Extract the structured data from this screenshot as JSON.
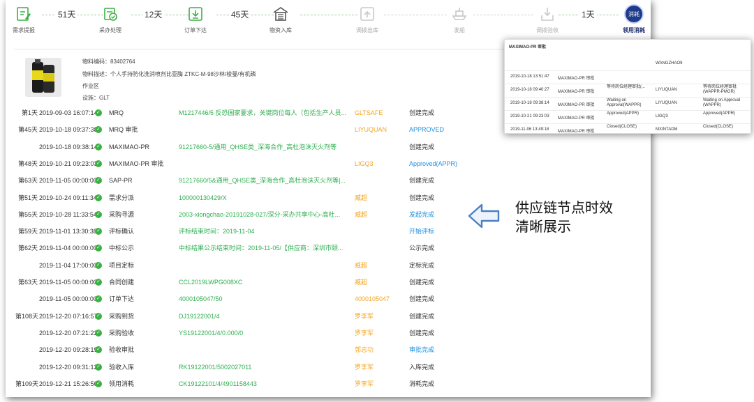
{
  "stepper": {
    "steps": [
      {
        "label": "需求提报",
        "icon": "edit-icon",
        "state": "done"
      },
      {
        "label": "采办处理",
        "icon": "cart-check-icon",
        "state": "done"
      },
      {
        "label": "订单下达",
        "icon": "download-box-icon",
        "state": "done"
      },
      {
        "label": "物资入库",
        "icon": "warehouse-icon",
        "state": "done"
      },
      {
        "label": "调拨出库",
        "icon": "upload-box-icon",
        "state": "pending"
      },
      {
        "label": "发船",
        "icon": "ship-icon",
        "state": "pending"
      },
      {
        "label": "调拨验收",
        "icon": "receive-box-icon",
        "state": "pending"
      },
      {
        "label": "领用消耗",
        "icon": "consume-icon",
        "state": "active",
        "badge": "消耗"
      }
    ],
    "durations": [
      "51天",
      "12天",
      "45天",
      "1天"
    ]
  },
  "material": {
    "code_label": "物料编码",
    "code": "83402764",
    "desc_label": "物料描述",
    "desc": "个人手持防化洗消喷剂比亚酶 ZTKC-M-98沙林/梭曼/有机磷",
    "area_label": "作业区",
    "area": "",
    "facility_label": "设施",
    "facility": "GLT"
  },
  "timeline": [
    {
      "day": "第1天",
      "time": "2019-09-03 16:07:14",
      "node": "MRQ",
      "doc": "M1217446/5 反恐国家要求，关键岗位每人（包括生产人员...",
      "user": "GLTSAFE",
      "status": "创建完成",
      "status_blue": false
    },
    {
      "day": "第45天",
      "time": "2019-10-18 09:37:38",
      "node": "MRQ 审批",
      "doc": "",
      "user": "LIYUQUAN",
      "status": "APPROVED",
      "status_blue": true
    },
    {
      "day": "",
      "time": "2019-10-18 09:38:14",
      "node": "MAXIMAO-PR",
      "doc": "91217660-5/通用_QHSE类_深海合作_高杜泡沫灭火剂等",
      "user": "",
      "status": "创建完成",
      "status_blue": false
    },
    {
      "day": "第48天",
      "time": "2019-10-21 09:23:03",
      "node": "MAXIMAO-PR 审批",
      "doc": "",
      "user": "LIGQ3",
      "status": "Approved(APPR)",
      "status_blue": true
    },
    {
      "day": "第63天",
      "time": "2019-11-05 00:00:00",
      "node": "SAP-PR",
      "doc": "91217660/5&通用_QHSE类_深海合作_高杜泡沫灭火剂等|...",
      "user": "",
      "status": "创建完成",
      "status_blue": false
    },
    {
      "day": "第51天",
      "time": "2019-10-24 09:11:34",
      "node": "需求分派",
      "doc": "100000130429/X",
      "user": "臧超",
      "status": "创建完成",
      "status_blue": false
    },
    {
      "day": "第55天",
      "time": "2019-10-28 11:33:54",
      "node": "采购寻源",
      "doc": "2003-xiongchao-20191028-027/深分-采办共享中心-高杜...",
      "user": "臧超",
      "status": "发起完成",
      "status_blue": true
    },
    {
      "day": "第59天",
      "time": "2019-11-01 13:30:38",
      "node": "评标确认",
      "doc": "评标结束时间：2019-11-04",
      "user": "",
      "status": "开始评标",
      "status_blue": true
    },
    {
      "day": "第62天",
      "time": "2019-11-04 00:00:00",
      "node": "中标公示",
      "doc": "中标结果公示结束时间：2019-11-05/【供应商：深圳市颐...",
      "user": "",
      "status": "公示完成",
      "status_blue": false
    },
    {
      "day": "",
      "time": "2019-11-04 17:00:00",
      "node": "项目定标",
      "doc": "",
      "user": "臧超",
      "status": "定标完成",
      "status_blue": false
    },
    {
      "day": "第63天",
      "time": "2019-11-05 00:00:00",
      "node": "合同创建",
      "doc": "CCL2019LWPG008XC",
      "user": "臧超",
      "status": "创建完成",
      "status_blue": false
    },
    {
      "day": "",
      "time": "2019-11-05 00:00:00",
      "node": "订单下达",
      "doc": "4000105047/50",
      "user": "4000105047",
      "status": "创建完成",
      "status_blue": false
    },
    {
      "day": "第108天",
      "time": "2019-12-20 07:16:57",
      "node": "采购到货",
      "doc": "DJ19122001/4",
      "user": "罗李军",
      "status": "创建完成",
      "status_blue": false
    },
    {
      "day": "",
      "time": "2019-12-20 07:21:22",
      "node": "采购验收",
      "doc": "YS19122001/4/0.000/0",
      "user": "罗李军",
      "status": "创建完成",
      "status_blue": false
    },
    {
      "day": "",
      "time": "2019-12-20 09:28:19",
      "node": "验收审批",
      "doc": "",
      "user": "郭志功",
      "status": "审批完成",
      "status_blue": true
    },
    {
      "day": "",
      "time": "2019-12-20 09:31:12",
      "node": "验收入库",
      "doc": "RK19122001/5002027011",
      "user": "罗李军",
      "status": "入库完成",
      "status_blue": false
    },
    {
      "day": "第109天",
      "time": "2019-12-21 15:26:50",
      "node": "领用消耗",
      "doc": "CK19122101/4/4901158443",
      "user": "罗李军",
      "status": "消耗完成",
      "status_blue": false
    }
  ],
  "popup": {
    "title": "MAXIMAO-PR 审批",
    "rows": [
      {
        "time": "",
        "node": "",
        "status": "",
        "user": "WANGZHAO9",
        "remark": ""
      },
      {
        "time": "2019-10-18 13:51:47",
        "node": "MAXIMAO-PR 审批",
        "status": "",
        "user": "",
        "remark": ""
      },
      {
        "time": "2019-10-18 09:40:27",
        "node": "MAXIMAO-PR 审批",
        "status": "等待岗位经理审批(...",
        "user": "LIYUQUAN",
        "remark": "等待岗位经理审批(WAPPR-PMGR)"
      },
      {
        "time": "2019-10-18 09:38:14",
        "node": "MAXIMAO-PR 审批",
        "status": "Waiting on Approval(WAPPR)",
        "user": "LIYUQUAN",
        "remark": "Waiting on Approval (WAPPR)"
      },
      {
        "time": "2019-10-21 09:23:03",
        "node": "MAXIMAO-PR 审批",
        "status": "Approved(APPR)",
        "user": "LIGQ3",
        "remark": "Approved(APPR)"
      },
      {
        "time": "2019-11-06 13:49:18",
        "node": "MAXIMAO-PR 审批",
        "status": "Closed(CLOSE)",
        "user": "MXINTADM",
        "remark": "Closed(CLOSE)"
      }
    ]
  },
  "caption": {
    "line1": "供应链节点时效",
    "line2": "清晰展示"
  },
  "colors": {
    "done": "#3cb043",
    "pending": "#c8c8c8",
    "active": "#1e3a8a",
    "doc_green": "#2eae4f",
    "user_orange": "#f5a623",
    "status_blue": "#1a8fe0",
    "arrow_blue": "#4a7fc1"
  }
}
